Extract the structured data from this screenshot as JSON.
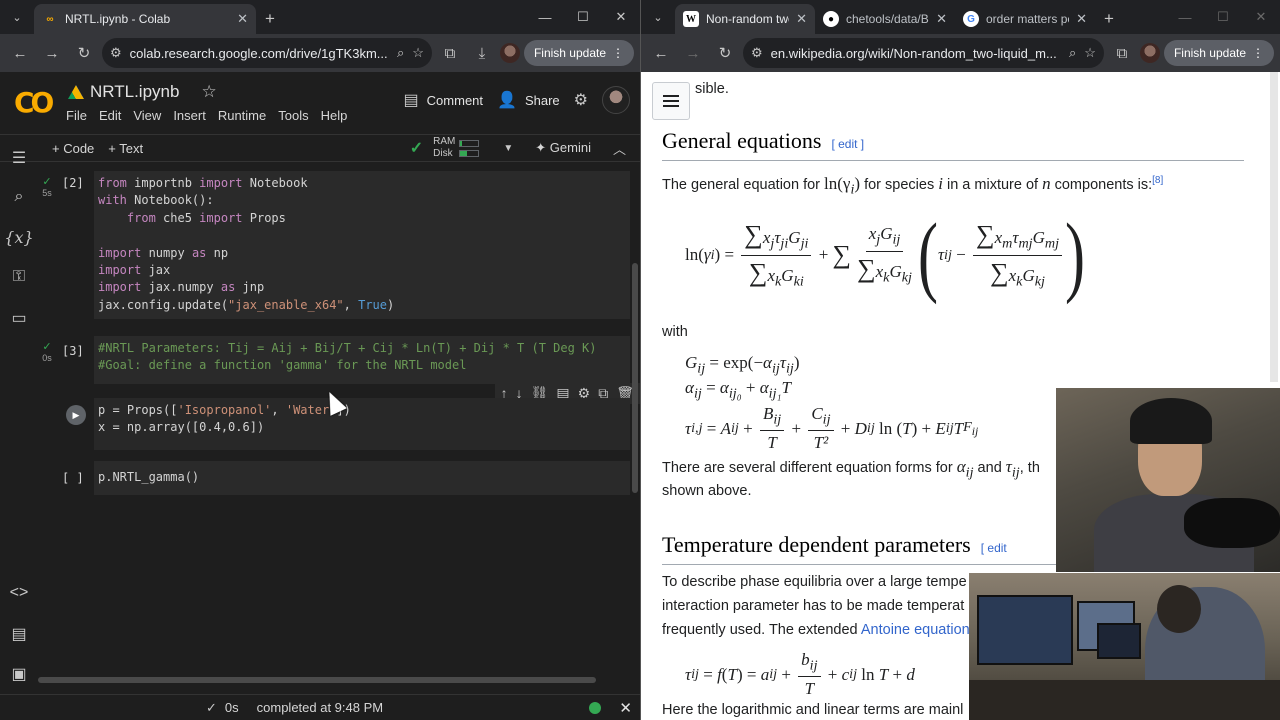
{
  "left_window": {
    "tab": {
      "title": "NRTL.ipynb - Colab",
      "favicon": "colab-icon"
    },
    "address": {
      "url": "colab.research.google.com/drive/1gTK3km..."
    },
    "finish_update": "Finish update",
    "colab": {
      "logo": "CO",
      "notebook_title": "NRTL.ipynb",
      "menu": [
        "File",
        "Edit",
        "View",
        "Insert",
        "Runtime",
        "Tools",
        "Help"
      ],
      "comment": "Comment",
      "share": "Share",
      "add_code": "+ Code",
      "add_text": "+ Text",
      "ram_label": "RAM",
      "disk_label": "Disk",
      "gemini": "Gemini",
      "cells": [
        {
          "exec": "[2]",
          "time": "5s",
          "lines": []
        },
        {
          "exec": "[3]",
          "time": "0s",
          "lines": []
        },
        {
          "exec": "",
          "time": "",
          "lines": []
        },
        {
          "exec": "[ ]",
          "time": "",
          "lines": []
        }
      ]
    },
    "status": {
      "time": "0s",
      "message": "completed at 9:48 PM"
    }
  },
  "right_window": {
    "tabs": [
      {
        "title": "Non-random two-",
        "favicon": "wikipedia-icon"
      },
      {
        "title": "chetools/data/Bin",
        "favicon": "github-icon"
      },
      {
        "title": "order matters pen",
        "favicon": "google-icon"
      }
    ],
    "address": {
      "url": "en.wikipedia.org/wiki/Non-random_two-liquid_m..."
    },
    "finish_update": "Finish update",
    "article": {
      "frag_top": "sible.",
      "h_general": "General equations",
      "edit": "[ edit ]",
      "p1_before": "The general equation for ",
      "p1_math1": "ln(γ",
      "p1_math1_sub": "i",
      "p1_mid": " for species ",
      "p1_i": "i",
      "p1_mid2": " in a mixture of ",
      "p1_n": "n",
      "p1_after": " components is:",
      "p1_ref": "[8]",
      "with": "with",
      "p2": "There are several different equation forms for ",
      "p2_end": ", th",
      "p3": "shown above.",
      "h_temp": "Temperature dependent parameters",
      "edit2": "[ edit",
      "p4a": "To describe phase equilibria over a large tempe",
      "p4b": "interaction parameter has to be made temperat",
      "p4c_before": "frequently used. The extended ",
      "p4c_link": "Antoine equation",
      "p5": "Here the logarithmic and linear terms are mainl"
    }
  }
}
